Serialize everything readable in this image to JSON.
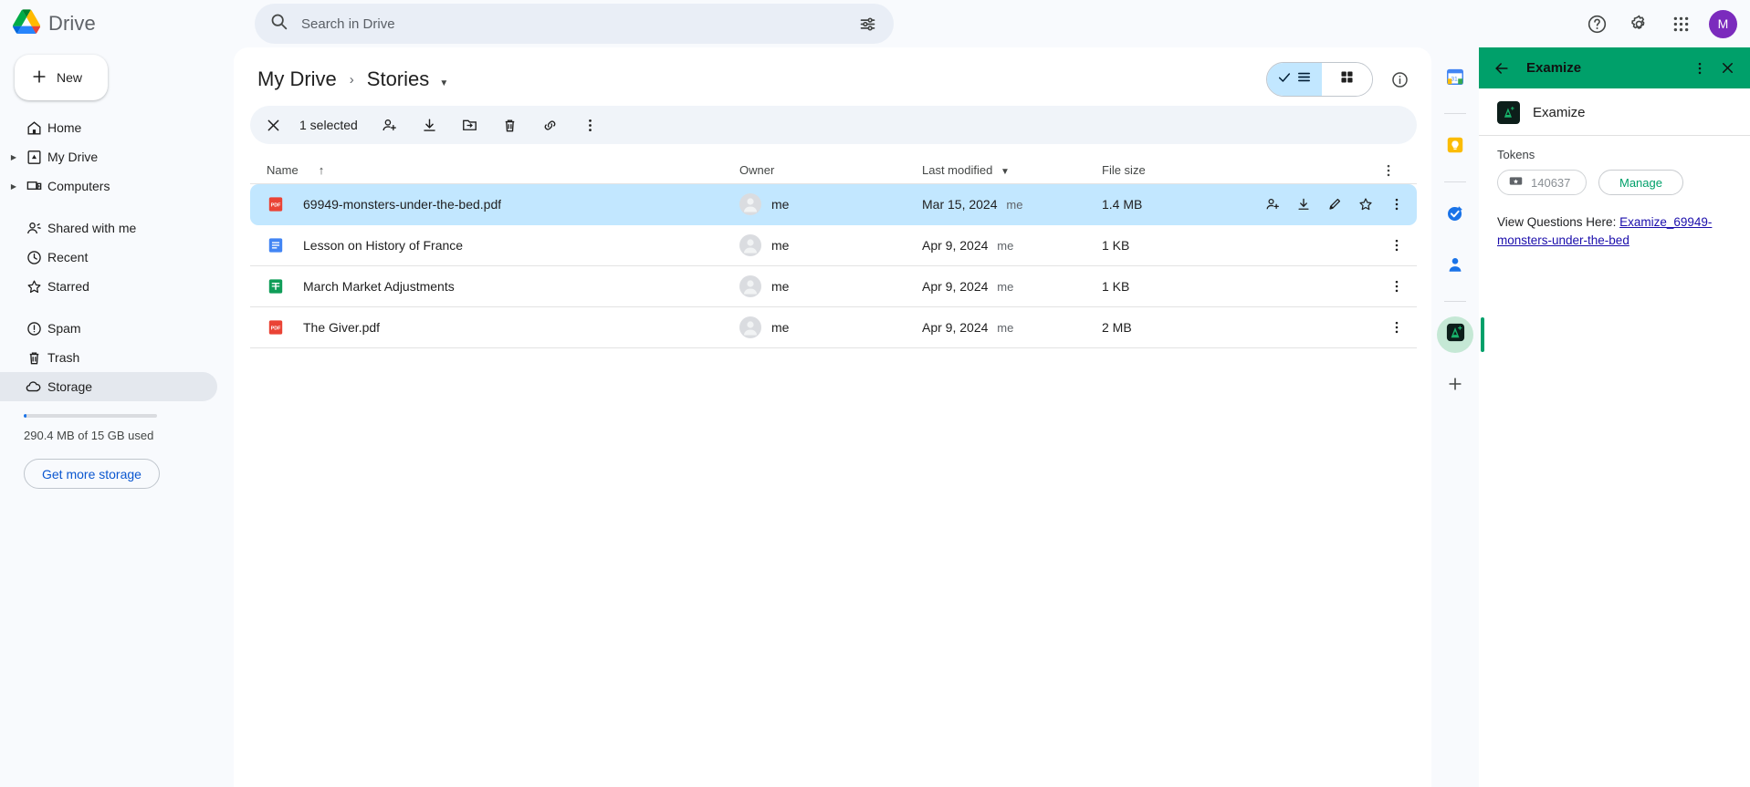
{
  "app": {
    "brand": "Drive",
    "logo_icon": "drive-triangle-logo"
  },
  "search": {
    "placeholder": "Search in Drive",
    "value": "",
    "search_icon": "search-icon",
    "options_icon": "search-options-icon"
  },
  "topbar": {
    "help_icon": "help-circle-icon",
    "settings_icon": "gear-icon",
    "apps_icon": "apps-grid-icon",
    "avatar_initial": "M",
    "avatar_color": "#7b2bbd"
  },
  "sidebar": {
    "new_label": "New",
    "new_icon": "plus-icon",
    "items": [
      {
        "label": "Home",
        "icon": "home-icon",
        "caret": false,
        "active": false
      },
      {
        "label": "My Drive",
        "icon": "my-drive-icon",
        "caret": true,
        "active": false
      },
      {
        "label": "Computers",
        "icon": "computers-icon",
        "caret": true,
        "active": false
      },
      {
        "label": "Shared with me",
        "icon": "shared-people-icon",
        "caret": false,
        "active": false
      },
      {
        "label": "Recent",
        "icon": "clock-icon",
        "caret": false,
        "active": false
      },
      {
        "label": "Starred",
        "icon": "star-icon",
        "caret": false,
        "active": false
      },
      {
        "label": "Spam",
        "icon": "spam-icon",
        "caret": false,
        "active": false
      },
      {
        "label": "Trash",
        "icon": "trash-icon",
        "caret": false,
        "active": false
      },
      {
        "label": "Storage",
        "icon": "cloud-icon",
        "caret": false,
        "active": true
      }
    ],
    "storage_text": "290.4 MB of 15 GB used",
    "storage_percent": 2,
    "get_storage_label": "Get more storage"
  },
  "breadcrumb": {
    "root": "My Drive",
    "separator": "›",
    "current": "Stories",
    "caret_icon": "chevron-down-icon"
  },
  "view_toggle": {
    "list_icon": "list-view-icon",
    "grid_icon": "grid-view-icon",
    "active": "list",
    "check_icon": "check-icon",
    "info_icon": "info-circle-icon"
  },
  "selection_toolbar": {
    "close_icon": "close-icon",
    "count_label": "1 selected",
    "actions": [
      {
        "name": "share-button",
        "icon": "person-add-icon"
      },
      {
        "name": "download-button",
        "icon": "download-icon"
      },
      {
        "name": "move-to-folder-button",
        "icon": "folder-move-icon"
      },
      {
        "name": "delete-button",
        "icon": "trash-icon"
      },
      {
        "name": "get-link-button",
        "icon": "link-icon"
      },
      {
        "name": "more-actions-button",
        "icon": "more-vertical-icon"
      }
    ]
  },
  "table": {
    "columns": {
      "name": "Name",
      "owner": "Owner",
      "modified": "Last modified",
      "size": "File size"
    },
    "sort_icon": "arrow-up-icon",
    "modified_caret": "chevron-down-icon",
    "header_more_icon": "more-vertical-icon",
    "rows": [
      {
        "name": "69949-monsters-under-the-bed.pdf",
        "type": "pdf",
        "owner": "me",
        "modified": "Mar 15, 2024",
        "modified_by": "me",
        "size": "1.4 MB",
        "selected": true
      },
      {
        "name": "Lesson on History of France",
        "type": "doc",
        "owner": "me",
        "modified": "Apr 9, 2024",
        "modified_by": "me",
        "size": "1 KB",
        "selected": false
      },
      {
        "name": "March Market Adjustments",
        "type": "sheet",
        "owner": "me",
        "modified": "Apr 9, 2024",
        "modified_by": "me",
        "size": "1 KB",
        "selected": false
      },
      {
        "name": "The Giver.pdf",
        "type": "pdf",
        "owner": "me",
        "modified": "Apr 9, 2024",
        "modified_by": "me",
        "size": "2 MB",
        "selected": false
      }
    ],
    "row_actions": [
      {
        "name": "row-share-button",
        "icon": "person-add-icon"
      },
      {
        "name": "row-download-button",
        "icon": "download-icon"
      },
      {
        "name": "row-edit-button",
        "icon": "pencil-icon"
      },
      {
        "name": "row-star-button",
        "icon": "star-icon"
      },
      {
        "name": "row-more-button",
        "icon": "more-vertical-icon"
      }
    ]
  },
  "rail": {
    "items": [
      {
        "name": "calendar-addon",
        "icon": "calendar-icon",
        "active": false
      },
      {
        "name": "keep-addon",
        "icon": "keep-bulb-icon",
        "active": false
      },
      {
        "name": "tasks-addon",
        "icon": "tasks-check-icon",
        "active": false
      },
      {
        "name": "contacts-addon",
        "icon": "contacts-person-icon",
        "active": false
      },
      {
        "name": "examize-addon",
        "icon": "examize-logo-icon",
        "active": true
      }
    ],
    "add_label": "+",
    "add_icon": "plus-icon"
  },
  "panel": {
    "header_title": "Examize",
    "back_icon": "arrow-left-icon",
    "more_icon": "more-vertical-icon",
    "close_icon": "close-icon",
    "accent_color": "#00a06a",
    "addon_name": "Examize",
    "addon_logo_icon": "examize-logo-icon",
    "tokens_label": "Tokens",
    "token_icon": "ticket-icon",
    "token_count": "140637",
    "manage_label": "Manage",
    "message_prefix": "View Questions Here: ",
    "message_link": "Examize_69949-monsters-under-the-bed"
  }
}
